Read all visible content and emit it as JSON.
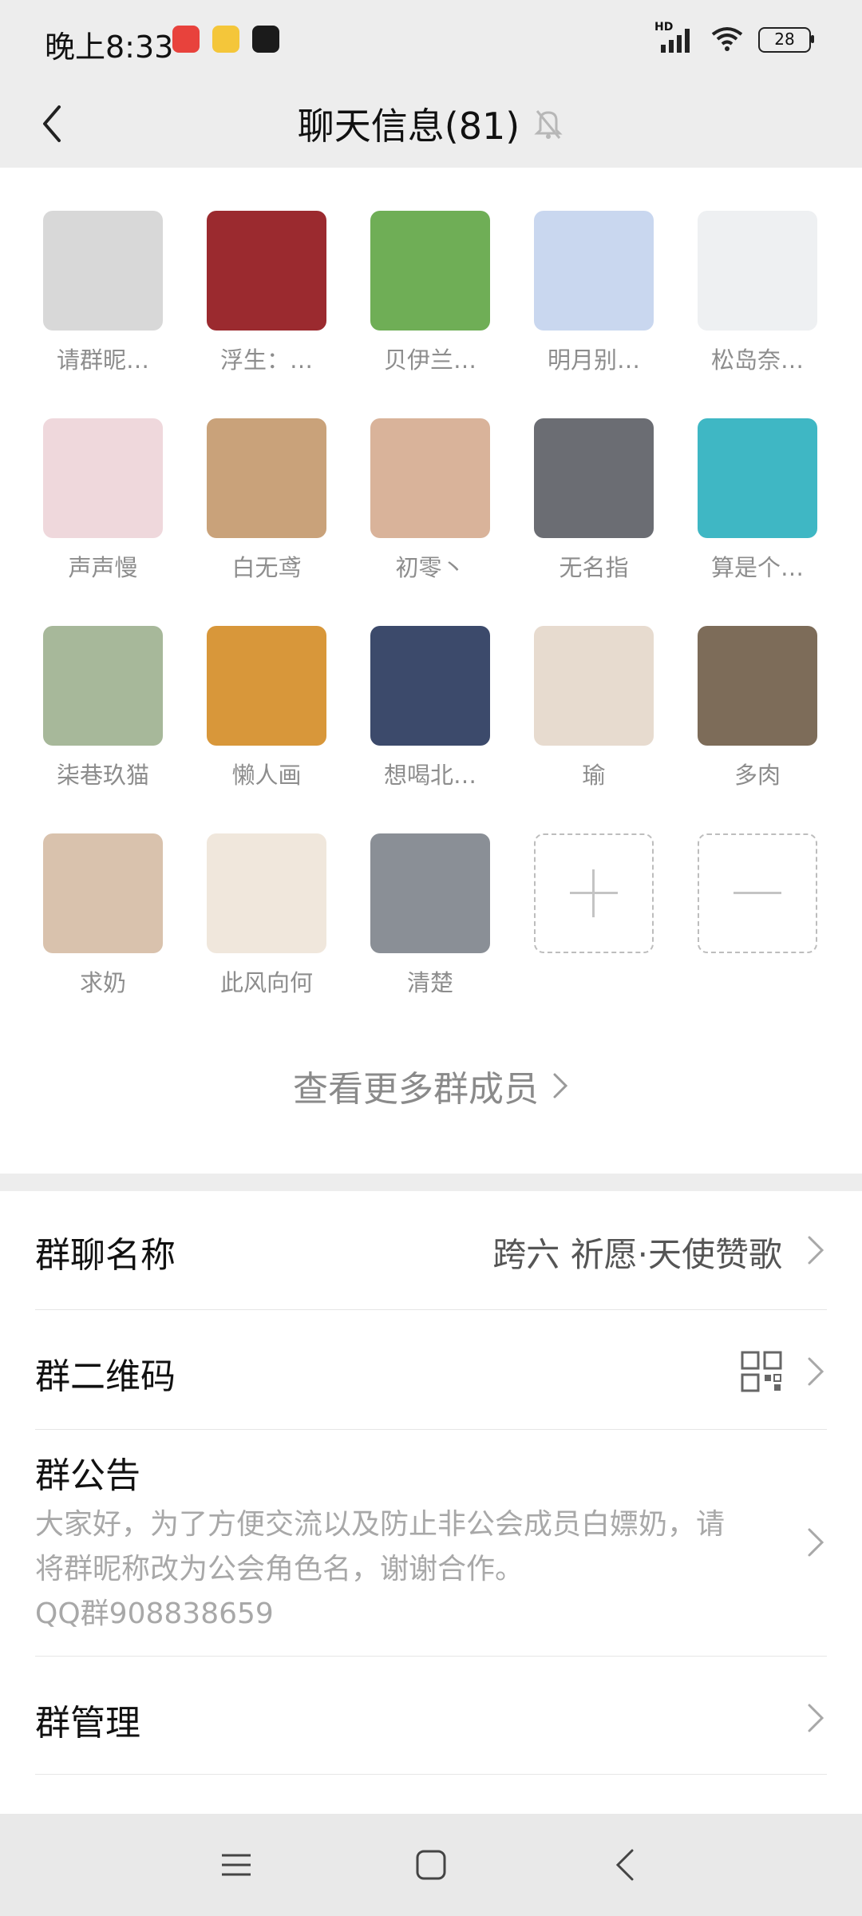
{
  "status": {
    "time": "晚上8:33",
    "battery": "28",
    "network_label": "HD"
  },
  "header": {
    "title": "聊天信息(81)"
  },
  "members": [
    {
      "name": "请群昵…",
      "color": "#d8d8d8"
    },
    {
      "name": "浮生：…",
      "color": "#9b2a2f"
    },
    {
      "name": "贝伊兰…",
      "color": "#6fae56"
    },
    {
      "name": "明月别…",
      "color": "#c9d7ef"
    },
    {
      "name": "松岛奈…",
      "color": "#eef0f2"
    },
    {
      "name": "声声慢",
      "color": "#efd8dc"
    },
    {
      "name": "白无鸢",
      "color": "#c9a27a"
    },
    {
      "name": "初零丶",
      "color": "#d9b39a"
    },
    {
      "name": "无名指",
      "color": "#6b6d73"
    },
    {
      "name": "算是个…",
      "color": "#3fb7c4"
    },
    {
      "name": "柒巷玖猫",
      "color": "#a7b89a"
    },
    {
      "name": "懒人画",
      "color": "#d8973a"
    },
    {
      "name": "想喝北…",
      "color": "#3c4a6b"
    },
    {
      "name": "瑜",
      "color": "#e7dbcf"
    },
    {
      "name": "多肉",
      "color": "#7d6c59"
    },
    {
      "name": "求奶",
      "color": "#d9c2ad"
    },
    {
      "name": "此风向何",
      "color": "#f0e7dc"
    },
    {
      "name": "清楚",
      "color": "#8a8f96"
    }
  ],
  "view_more": "查看更多群成员",
  "settings": {
    "group_name_label": "群聊名称",
    "group_name_value": "跨六 祈愿·天使赞歌",
    "qr_label": "群二维码",
    "announce_label": "群公告",
    "announce_line1": "大家好，为了方便交流以及防止非公会成员白嫖奶，请",
    "announce_line2": "将群昵称改为公会角色名，谢谢合作。",
    "announce_line3": "QQ群908838659",
    "manage_label": "群管理"
  }
}
